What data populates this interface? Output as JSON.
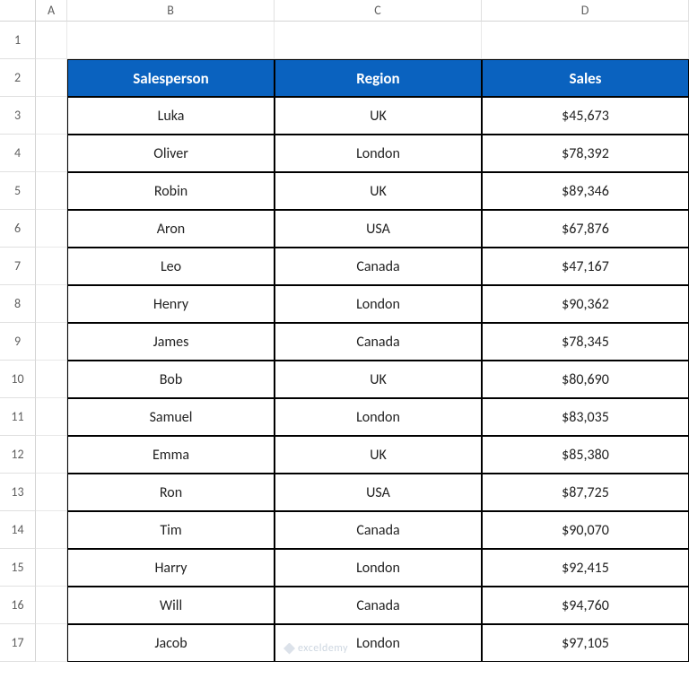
{
  "columns": [
    "",
    "A",
    "B",
    "C",
    "D"
  ],
  "rows": [
    "1",
    "2",
    "3",
    "4",
    "5",
    "6",
    "7",
    "8",
    "9",
    "10",
    "11",
    "12",
    "13",
    "14",
    "15",
    "16",
    "17"
  ],
  "table": {
    "headers": [
      "Salesperson",
      "Region",
      "Sales"
    ],
    "data": [
      {
        "salesperson": "Luka",
        "region": "UK",
        "sales": "$45,673"
      },
      {
        "salesperson": "Oliver",
        "region": "London",
        "sales": "$78,392"
      },
      {
        "salesperson": "Robin",
        "region": "UK",
        "sales": "$89,346"
      },
      {
        "salesperson": "Aron",
        "region": "USA",
        "sales": "$67,876"
      },
      {
        "salesperson": "Leo",
        "region": "Canada",
        "sales": "$47,167"
      },
      {
        "salesperson": "Henry",
        "region": "London",
        "sales": "$90,362"
      },
      {
        "salesperson": "James",
        "region": "Canada",
        "sales": "$78,345"
      },
      {
        "salesperson": "Bob",
        "region": "UK",
        "sales": "$80,690"
      },
      {
        "salesperson": "Samuel",
        "region": "London",
        "sales": "$83,035"
      },
      {
        "salesperson": "Emma",
        "region": "UK",
        "sales": "$85,380"
      },
      {
        "salesperson": "Ron",
        "region": "USA",
        "sales": "$87,725"
      },
      {
        "salesperson": "Tim",
        "region": "Canada",
        "sales": "$90,070"
      },
      {
        "salesperson": "Harry",
        "region": "London",
        "sales": "$92,415"
      },
      {
        "salesperson": "Will",
        "region": "Canada",
        "sales": "$94,760"
      },
      {
        "salesperson": "Jacob",
        "region": "London",
        "sales": "$97,105"
      }
    ]
  },
  "watermark": "exceldemy"
}
